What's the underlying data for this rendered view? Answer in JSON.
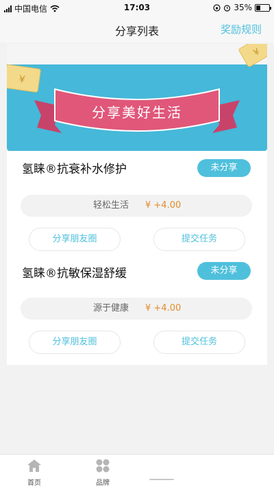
{
  "status_bar": {
    "carrier": "中国电信",
    "time": "17:03",
    "battery": "35%"
  },
  "nav": {
    "title": "分享列表",
    "right_link": "奖励规则"
  },
  "banner": {
    "text": "分享美好生活"
  },
  "items": [
    {
      "title": "氢睐®抗衰补水修护",
      "status": "未分享",
      "info_label": "轻松生活",
      "price": "¥ +4.00",
      "share_button": "分享朋友圈",
      "submit_button": "提交任务"
    },
    {
      "title": "氢睐®抗敏保湿舒缓",
      "status": "未分享",
      "info_label": "源于健康",
      "price": "¥ +4.00",
      "share_button": "分享朋友圈",
      "submit_button": "提交任务"
    }
  ],
  "tabs": [
    {
      "label": "首页",
      "icon": "home-icon"
    },
    {
      "label": "品牌",
      "icon": "brand-grid-icon"
    }
  ],
  "colors": {
    "accent": "#4fc0dc",
    "price": "#e38b2c",
    "banner": "#46b8d9",
    "ribbon": "#e0577a"
  }
}
